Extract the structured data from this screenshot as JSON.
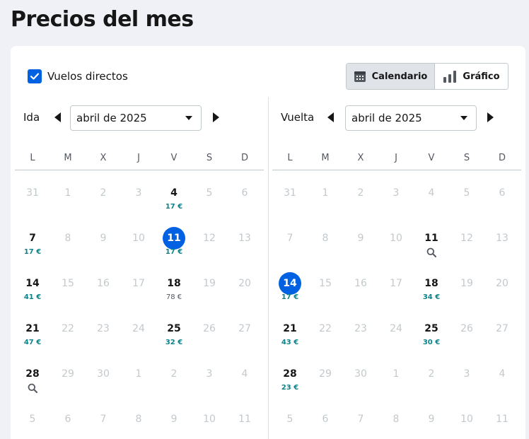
{
  "page": {
    "title": "Precios del mes"
  },
  "filters": {
    "direct_label": "Vuelos directos",
    "direct_checked": true
  },
  "view_toggle": {
    "calendar_label": "Calendario",
    "chart_label": "Gráfico",
    "active": "calendar"
  },
  "colors": {
    "accent": "#0062e3",
    "price_low": "#0c838a",
    "price_mid": "#545860",
    "muted": "#c2c9cd"
  },
  "weekday_labels": [
    "L",
    "M",
    "X",
    "J",
    "V",
    "S",
    "D"
  ],
  "outbound": {
    "label": "Ida",
    "month": "abril de 2025",
    "weeks": [
      [
        {
          "d": "31",
          "dim": true
        },
        {
          "d": "1",
          "dim": true
        },
        {
          "d": "2",
          "dim": true
        },
        {
          "d": "3",
          "dim": true
        },
        {
          "d": "4",
          "p": "17 €"
        },
        {
          "d": "5",
          "dim": true
        },
        {
          "d": "6",
          "dim": true
        }
      ],
      [
        {
          "d": "7",
          "p": "17 €"
        },
        {
          "d": "8",
          "dim": true
        },
        {
          "d": "9",
          "dim": true
        },
        {
          "d": "10",
          "dim": true
        },
        {
          "d": "11",
          "p": "17 €",
          "sel": true
        },
        {
          "d": "12",
          "dim": true
        },
        {
          "d": "13",
          "dim": true
        }
      ],
      [
        {
          "d": "14",
          "p": "41 €"
        },
        {
          "d": "15",
          "dim": true
        },
        {
          "d": "16",
          "dim": true
        },
        {
          "d": "17",
          "dim": true
        },
        {
          "d": "18",
          "p": "78 €",
          "mid": true
        },
        {
          "d": "19",
          "dim": true
        },
        {
          "d": "20",
          "dim": true
        }
      ],
      [
        {
          "d": "21",
          "p": "47 €"
        },
        {
          "d": "22",
          "dim": true
        },
        {
          "d": "23",
          "dim": true
        },
        {
          "d": "24",
          "dim": true
        },
        {
          "d": "25",
          "p": "32 €"
        },
        {
          "d": "26",
          "dim": true
        },
        {
          "d": "27",
          "dim": true
        }
      ],
      [
        {
          "d": "28",
          "search": true
        },
        {
          "d": "29",
          "dim": true
        },
        {
          "d": "30",
          "dim": true
        },
        {
          "d": "1",
          "dim": true
        },
        {
          "d": "2",
          "dim": true
        },
        {
          "d": "3",
          "dim": true
        },
        {
          "d": "4",
          "dim": true
        }
      ],
      [
        {
          "d": "5",
          "dim": true
        },
        {
          "d": "6",
          "dim": true
        },
        {
          "d": "7",
          "dim": true
        },
        {
          "d": "8",
          "dim": true
        },
        {
          "d": "9",
          "dim": true
        },
        {
          "d": "10",
          "dim": true
        },
        {
          "d": "11",
          "dim": true
        }
      ]
    ]
  },
  "return": {
    "label": "Vuelta",
    "month": "abril de 2025",
    "weeks": [
      [
        {
          "d": "31",
          "dim": true
        },
        {
          "d": "1",
          "dim": true
        },
        {
          "d": "2",
          "dim": true
        },
        {
          "d": "3",
          "dim": true
        },
        {
          "d": "4",
          "dim": true
        },
        {
          "d": "5",
          "dim": true
        },
        {
          "d": "6",
          "dim": true
        }
      ],
      [
        {
          "d": "7",
          "dim": true
        },
        {
          "d": "8",
          "dim": true
        },
        {
          "d": "9",
          "dim": true
        },
        {
          "d": "10",
          "dim": true
        },
        {
          "d": "11",
          "search": true
        },
        {
          "d": "12",
          "dim": true
        },
        {
          "d": "13",
          "dim": true
        }
      ],
      [
        {
          "d": "14",
          "p": "17 €",
          "sel": true
        },
        {
          "d": "15",
          "dim": true
        },
        {
          "d": "16",
          "dim": true
        },
        {
          "d": "17",
          "dim": true
        },
        {
          "d": "18",
          "p": "34 €"
        },
        {
          "d": "19",
          "dim": true
        },
        {
          "d": "20",
          "dim": true
        }
      ],
      [
        {
          "d": "21",
          "p": "43 €"
        },
        {
          "d": "22",
          "dim": true
        },
        {
          "d": "23",
          "dim": true
        },
        {
          "d": "24",
          "dim": true
        },
        {
          "d": "25",
          "p": "30 €"
        },
        {
          "d": "26",
          "dim": true
        },
        {
          "d": "27",
          "dim": true
        }
      ],
      [
        {
          "d": "28",
          "p": "23 €"
        },
        {
          "d": "29",
          "dim": true
        },
        {
          "d": "30",
          "dim": true
        },
        {
          "d": "1",
          "dim": true
        },
        {
          "d": "2",
          "dim": true
        },
        {
          "d": "3",
          "dim": true
        },
        {
          "d": "4",
          "dim": true
        }
      ],
      [
        {
          "d": "5",
          "dim": true
        },
        {
          "d": "6",
          "dim": true
        },
        {
          "d": "7",
          "dim": true
        },
        {
          "d": "8",
          "dim": true
        },
        {
          "d": "9",
          "dim": true
        },
        {
          "d": "10",
          "dim": true
        },
        {
          "d": "11",
          "dim": true
        }
      ]
    ]
  }
}
